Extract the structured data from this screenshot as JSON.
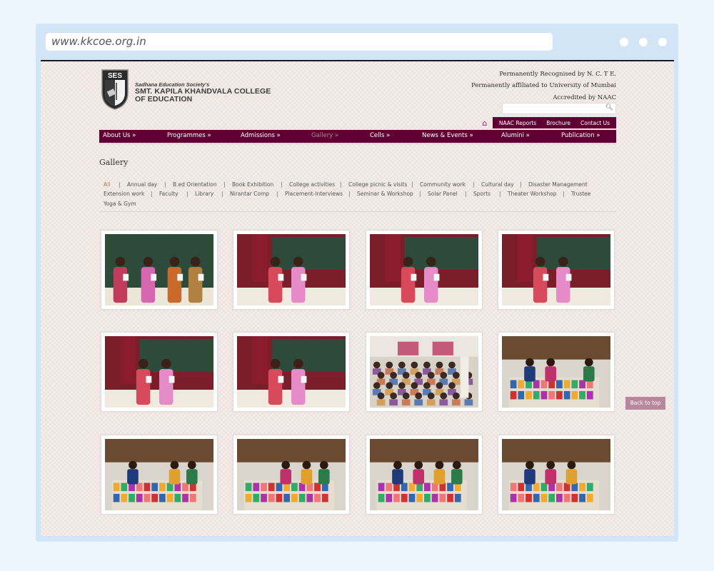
{
  "browser": {
    "url": "www.kkcoe.org.in"
  },
  "header": {
    "logo_initials": "SES",
    "society": "Sadhana Education Society's",
    "college_line1": "SMT. KAPILA KHANDVALA COLLEGE",
    "college_line2": "OF EDUCATION",
    "accreditation": [
      "Permanently Recognised by N. C. T E.",
      "Permanently affiliated to University of Mumbai",
      "Accredited by NAAC"
    ],
    "search_placeholder": "",
    "top_links": [
      "NAAC Reports",
      "Brochure",
      "Contact Us"
    ]
  },
  "main_nav": [
    {
      "label": "About Us »",
      "active": false
    },
    {
      "label": "Programmes »",
      "active": false
    },
    {
      "label": "Admissions »",
      "active": false
    },
    {
      "label": "Gallery »",
      "active": true
    },
    {
      "label": "Cells »",
      "active": false
    },
    {
      "label": "News & Events »",
      "active": false
    },
    {
      "label": "Alumini »",
      "active": false
    },
    {
      "label": "Publication »",
      "active": false
    }
  ],
  "page_title": "Gallery",
  "filters": [
    [
      "All",
      "Annual day",
      "B.ed Orientation",
      "Book Exhibition",
      "College activities",
      "College picnic & visits",
      "Community work",
      "Cultural day",
      "Disaster Management"
    ],
    [
      "Extension work",
      "Faculty",
      "Library",
      "Nirantar Comp",
      "Placement-Interviews",
      "Seminar & Workshop",
      "Solar Panel",
      "Sports",
      "Theater Workshop",
      "Trustee"
    ],
    [
      "Yoga & Gym"
    ]
  ],
  "active_filter": "All",
  "gallery": [
    {
      "scene": "felicitation-classroom"
    },
    {
      "scene": "felicitation-pink-saree"
    },
    {
      "scene": "felicitation-green-saree"
    },
    {
      "scene": "felicitation-red-saree"
    },
    {
      "scene": "felicitation-curtains"
    },
    {
      "scene": "felicitation-curtains-2"
    },
    {
      "scene": "seminar-hall"
    },
    {
      "scene": "book-exhibition"
    },
    {
      "scene": "book-exhibition-2"
    },
    {
      "scene": "book-exhibition-3"
    },
    {
      "scene": "book-exhibition-4"
    },
    {
      "scene": "book-exhibition-5"
    }
  ],
  "back_to_top": "Back to top",
  "colors": {
    "brand": "#610032",
    "active_filter": "#c8782e",
    "active_nav": "#a8838f",
    "back_to_top": "#b9879c"
  }
}
